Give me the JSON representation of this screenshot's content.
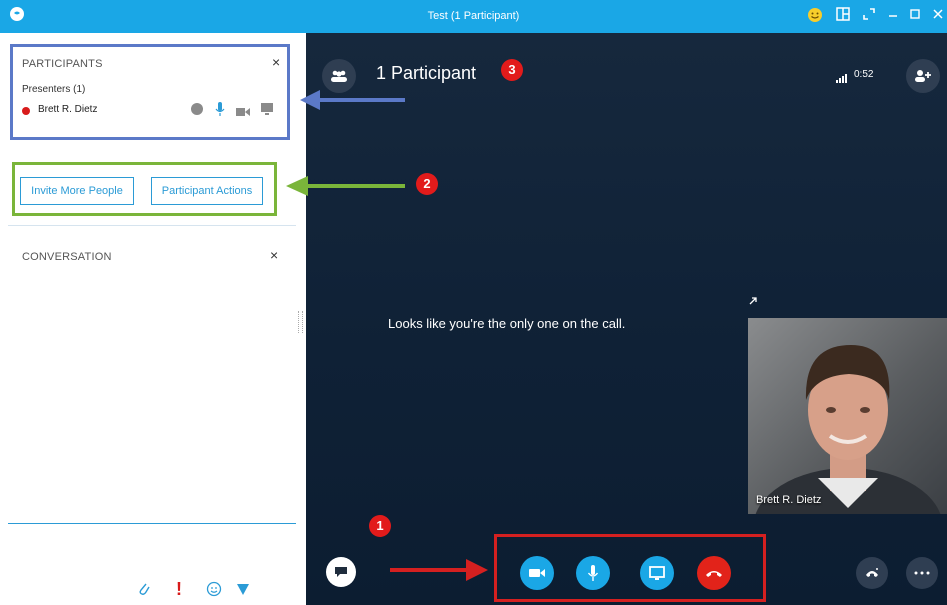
{
  "window": {
    "title": "Test (1 Participant)"
  },
  "left_pane": {
    "participants": {
      "title": "PARTICIPANTS",
      "presenters_label": "Presenters (1)",
      "participant_name": "Brett R. Dietz"
    },
    "actions": {
      "invite_label": "Invite More People",
      "participant_actions_label": "Participant Actions"
    },
    "conversation": {
      "title": "CONVERSATION"
    }
  },
  "stage": {
    "header_title": "1 Participant",
    "call_timer": "0:52",
    "message": "Looks like you're the only one on the call.",
    "self_video_name": "Brett R. Dietz"
  },
  "annotations": {
    "badge_1": "1",
    "badge_2": "2",
    "badge_3": "3",
    "colors": {
      "blue": "#5b79c8",
      "green": "#7ab53a",
      "red": "#d52020"
    }
  },
  "icons": [
    "skype-icon",
    "emoji-icon",
    "layout-icon",
    "fullscreen-icon",
    "minimize-icon",
    "maximize-icon",
    "close-icon",
    "participants-icon",
    "signal-icon",
    "add-person-icon",
    "im-icon",
    "video-icon",
    "mic-icon",
    "screen-share-icon",
    "hangup-icon",
    "dialpad-icon",
    "more-icon",
    "attach-icon",
    "important-icon",
    "smiley-icon",
    "send-icon",
    "popout-icon"
  ]
}
